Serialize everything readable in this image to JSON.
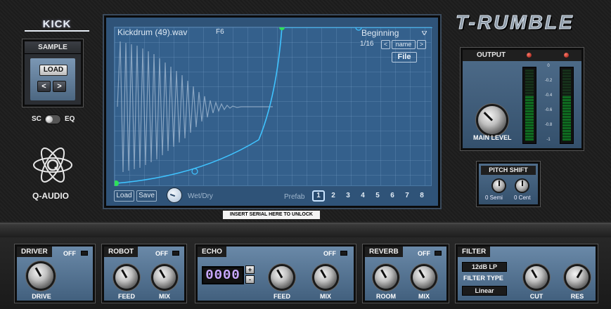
{
  "left": {
    "kick_title": "KICK",
    "sample_header": "SAMPLE",
    "load_label": "LOAD",
    "prev_label": "<",
    "next_label": ">",
    "sc_label": "SC",
    "eq_label": "EQ",
    "logo_text": "Q-AUDIO"
  },
  "display": {
    "file_name": "Kickdrum (49).wav",
    "note": "F6",
    "preset_name": "Beginning",
    "preset_menu_icon": "triangle-down-icon",
    "step": "1/16",
    "nav_prev": "<",
    "nav_name": "name",
    "nav_next": ">",
    "file_label": "File",
    "load_label": "Load",
    "save_label": "Save",
    "wet_dry_label": "Wet/Dry",
    "prefab_label": "Prefab",
    "prefab_numbers": [
      "1",
      "2",
      "3",
      "4",
      "5",
      "6",
      "7",
      "8"
    ],
    "prefab_active": "1",
    "serial_notice": "INSERT SERIAL HERE TO UNLOCK"
  },
  "right": {
    "brand": "T-RUMBLE",
    "output_header": "OUTPUT",
    "main_level_label": "MAIN LEVEL",
    "meter_scale": [
      "0",
      "-0.2",
      "-0.4",
      "-0.6",
      "-0.8",
      "-1"
    ],
    "meter_left_level": 0.62,
    "meter_right_level": 0.62,
    "pitch_header": "PITCH SHIFT",
    "semi_label": "0 Semi",
    "cent_label": "0 Cent"
  },
  "fx": {
    "driver": {
      "title": "DRIVER",
      "off": "OFF",
      "drive_label": "DRIVE"
    },
    "robot": {
      "title": "ROBOT",
      "off": "OFF",
      "feed_label": "FEED",
      "mix_label": "MIX"
    },
    "echo": {
      "title": "ECHO",
      "off": "OFF",
      "time_value": "0000",
      "up": "+",
      "down": "-",
      "feed_label": "FEED",
      "mix_label": "MIX"
    },
    "reverb": {
      "title": "REVERB",
      "off": "OFF",
      "room_label": "ROOM",
      "mix_label": "MIX"
    },
    "filter": {
      "title": "FILTER",
      "mode": "12dB LP",
      "type_label": "FILTER TYPE",
      "type_value": "Linear",
      "cut_label": "CUT",
      "res_label": "RES"
    }
  },
  "colors": {
    "display_bg": "#34608c",
    "curve": "#3fc3ff",
    "node": "#2ee05a",
    "led_red": "#d8251a"
  }
}
